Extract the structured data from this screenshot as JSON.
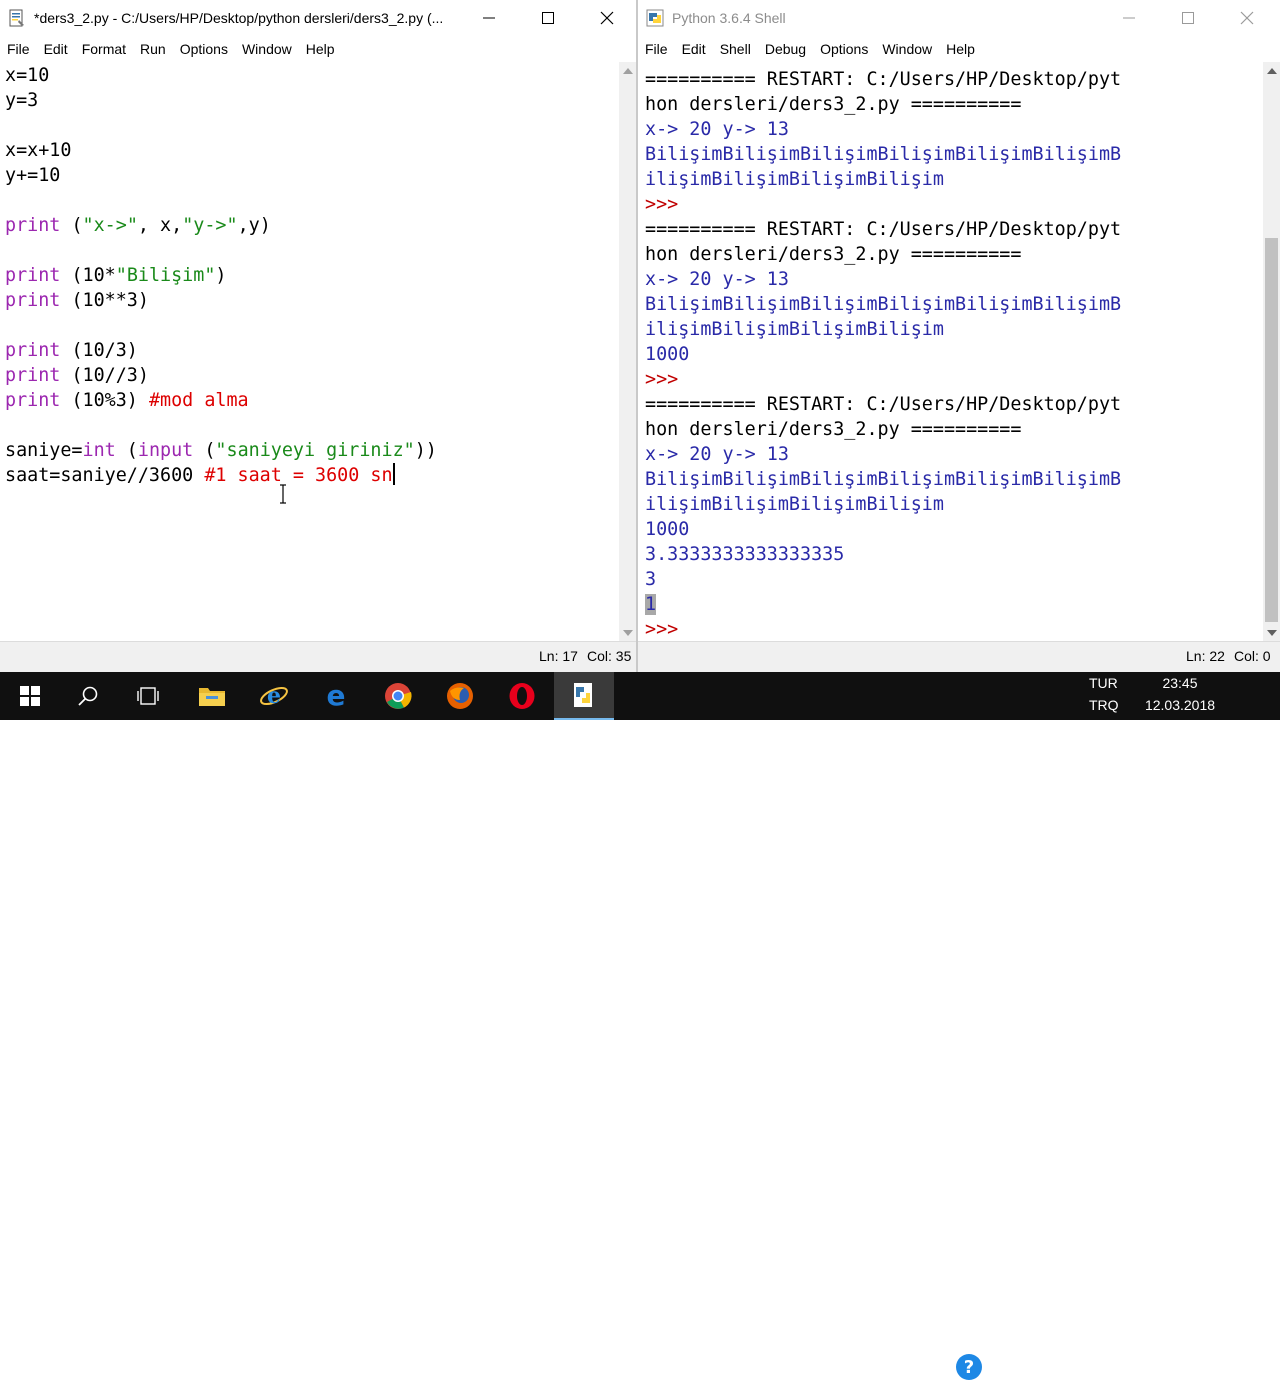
{
  "editor": {
    "title": "*ders3_2.py - C:/Users/HP/Desktop/python dersleri/ders3_2.py (...",
    "menu": [
      "File",
      "Edit",
      "Format",
      "Run",
      "Options",
      "Window",
      "Help"
    ],
    "status_line": "Ln: 17",
    "status_col": "Col: 35",
    "code": {
      "l1": "x=10",
      "l2": "y=3",
      "l4": "x=x+10",
      "l5": "y+=10",
      "print": "print",
      "l7_open": " (",
      "l7_s1": "\"x->\"",
      "l7_mid": ", x,",
      "l7_s2": "\"y->\"",
      "l7_end": ",y)",
      "l9_open": " (10*",
      "l9_s": "\"Bilişim\"",
      "l9_end": ")",
      "l10_rest": " (10**3)",
      "l12_rest": " (10/3)",
      "l13_rest": " (10//3)",
      "l14_rest": " (10%3) ",
      "l14_cmt": "#mod alma",
      "l16_a": "saniye=",
      "l16_int": "int",
      "l16_b": " (",
      "l16_input": "input",
      "l16_c": " (",
      "l16_s": "\"saniyeyi giriniz\"",
      "l16_d": "))",
      "l17_a": "saat=saniye//3600 ",
      "l17_cmt": "#1 saat = 3600 sn"
    }
  },
  "shell": {
    "title": "Python 3.6.4 Shell",
    "menu": [
      "File",
      "Edit",
      "Shell",
      "Debug",
      "Options",
      "Window",
      "Help"
    ],
    "status_line": "Ln: 22",
    "status_col": "Col: 0",
    "restart_1": "========== RESTART: C:/Users/HP/Desktop/pyt",
    "restart_2": "hon dersleri/ders3_2.py ==========",
    "xy_out": "x-> 20 y-> 13",
    "bil_1": "BilişimBilişimBilişimBilişimBilişimBilişimB",
    "bil_2": "ilişimBilişimBilişimBilişim",
    "prompt": ">>>",
    "thousand": "1000",
    "div": "3.3333333333333335",
    "floordiv": "3",
    "mod": "1"
  },
  "taskbar": {
    "lang_top": "TUR",
    "lang_bottom": "TRQ",
    "time": "23:45",
    "date": "12.03.2018"
  },
  "colors": {
    "keyword": "#9c27b0",
    "string": "#1a8a1a",
    "comment": "#dd0000",
    "output": "#2a2aa8",
    "prompt": "#c00000"
  }
}
